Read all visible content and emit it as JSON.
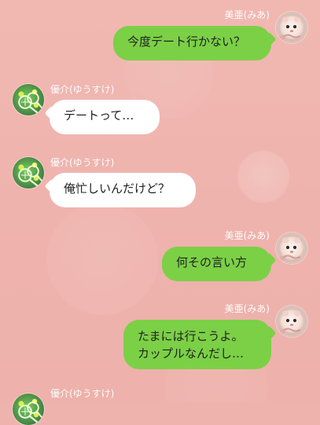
{
  "chat": {
    "messages": [
      {
        "sender": "美亜(みあ)",
        "text": "今度デート行かない？",
        "side": "right",
        "avatar_icon": "hamster-avatar-icon"
      },
      {
        "sender": "優介(ゆうすけ)",
        "text": "デートって…",
        "side": "left",
        "avatar_icon": "tennis-avatar-icon"
      },
      {
        "sender": "優介(ゆうすけ)",
        "text": "俺忙しいんだけど？",
        "side": "left",
        "avatar_icon": "tennis-avatar-icon"
      },
      {
        "sender": "美亜(みあ)",
        "text": "何その言い方",
        "side": "right",
        "avatar_icon": "hamster-avatar-icon"
      },
      {
        "sender": "美亜(みあ)",
        "text": "たまには行こうよ。\nカップルなんだし…",
        "side": "right",
        "avatar_icon": "hamster-avatar-icon"
      },
      {
        "sender": "優介(ゆうすけ)",
        "side": "left",
        "avatar_icon": "tennis-avatar-icon"
      }
    ]
  },
  "colors": {
    "background": "#efb3ad",
    "outgoing_bubble": "#7bd046",
    "incoming_bubble": "#ffffff",
    "sender_name": "#ffffff"
  }
}
